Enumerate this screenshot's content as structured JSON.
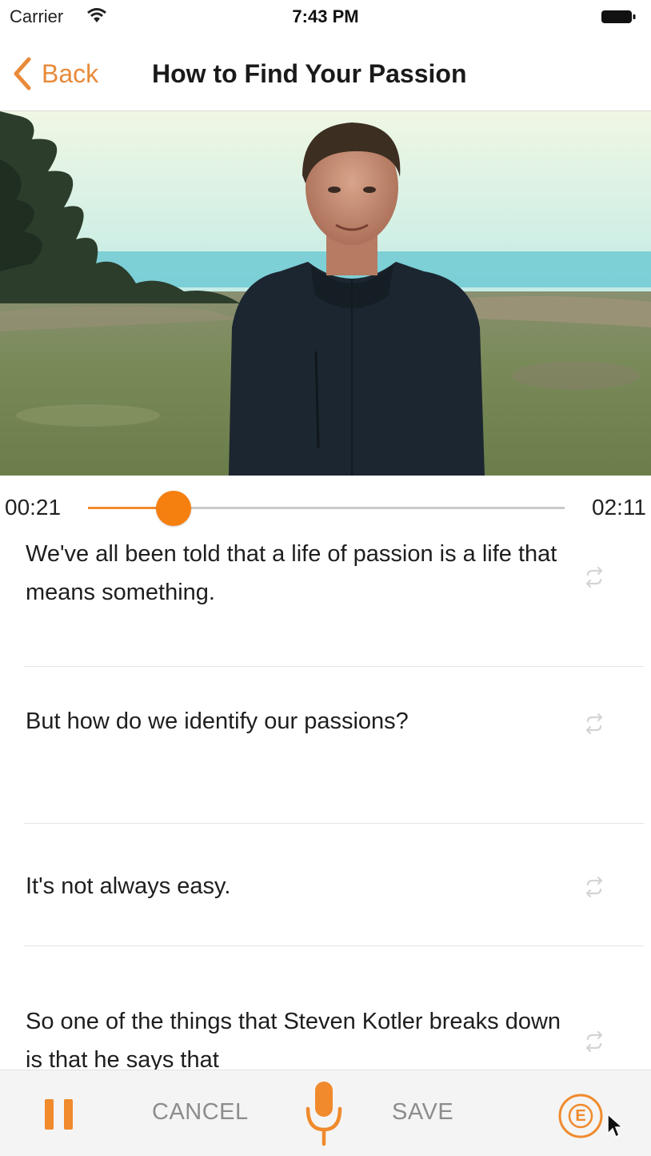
{
  "status_bar": {
    "carrier": "Carrier",
    "time": "7:43 PM"
  },
  "nav": {
    "back_label": "Back",
    "title": "How to Find Your Passion"
  },
  "player": {
    "current_time": "00:21",
    "duration": "02:11",
    "progress_fraction": 0.18
  },
  "transcript": [
    {
      "text": "We've all been told that a life of passion is a life that means something."
    },
    {
      "text": "But how do we identify our passions?"
    },
    {
      "text": "It's not always easy."
    },
    {
      "text": "So one of the things that Steven Kotler breaks down is that he says that"
    }
  ],
  "toolbar": {
    "cancel_label": "CANCEL",
    "save_label": "SAVE",
    "e_label": "E"
  },
  "colors": {
    "accent": "#f08a2c",
    "thumb": "#f57f0f",
    "secondary_text": "#8c8c8c"
  },
  "icons": [
    "wifi-icon",
    "battery-icon",
    "back-chevron-icon",
    "repeat-icon",
    "pause-icon",
    "microphone-icon",
    "e-circle-icon",
    "cursor-icon"
  ]
}
